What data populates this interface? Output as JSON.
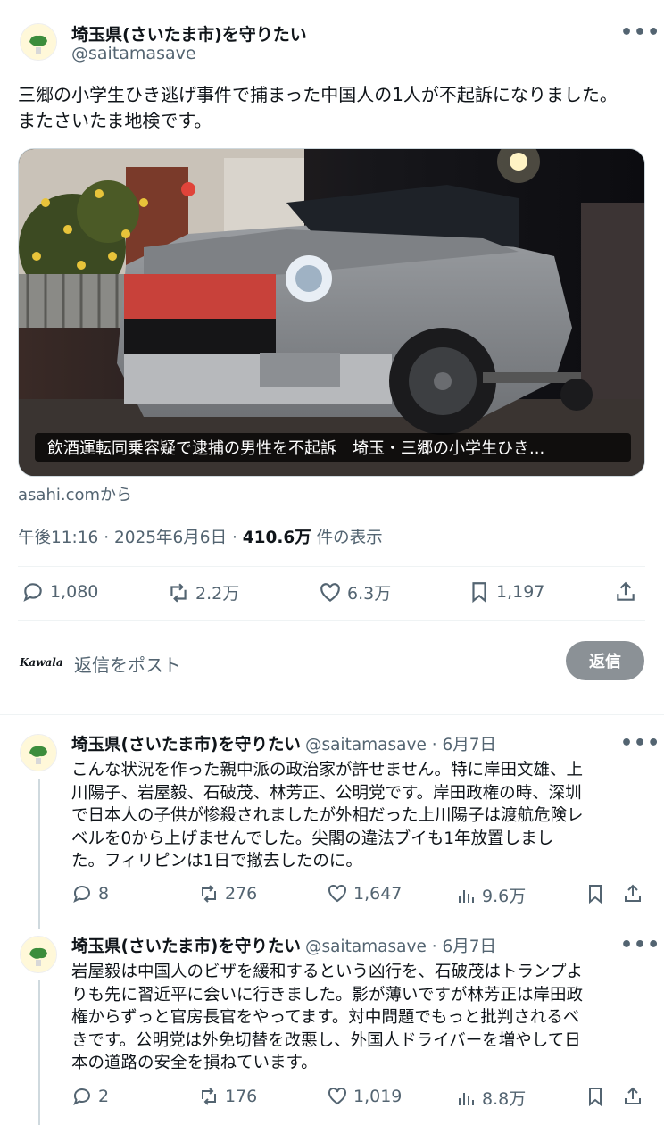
{
  "main_post": {
    "author_name": "埼玉県(さいたま市)を守りたい",
    "author_handle": "@saitamasave",
    "more_icon": "•••",
    "text_line1": "三郷の小学生ひき逃げ事件で捕まった中国人の1人が不起訴になりました。",
    "text_line2": "またさいたま地検です。",
    "card_caption": "飲酒運転同乗容疑で逮捕の男性を不起訴　埼玉・三郷の小学生ひき...",
    "card_source": "asahi.comから",
    "time": "午後11:16 · 2025年6月6日 · ",
    "views": "410.6万",
    "views_label": " 件の表示",
    "replies": "1,080",
    "reposts": "2.2万",
    "likes": "6.3万",
    "bookmarks": "1,197"
  },
  "reply_box": {
    "brand": "Kawala",
    "placeholder": "返信をポスト",
    "button": "返信"
  },
  "replies": [
    {
      "author_name": "埼玉県(さいたま市)を守りたい",
      "author_handle": "@saitamasave · 6月7日",
      "text_lines": [
        "こんな状況を作った親中派の政治家が許せません。特に岸田文雄、上",
        "川陽子、岩屋毅、石破茂、林芳正、公明党です。岸田政権の時、深圳",
        "で日本人の子供が惨殺されましたが外相だった上川陽子は渡航危険レ",
        "ベルを0から上げませんでした。尖閣の違法ブイも1年放置しまし",
        "た。フィリピンは1日で撤去したのに。"
      ],
      "replies": "8",
      "reposts": "276",
      "likes": "1,647",
      "views": "9.6万"
    },
    {
      "author_name": "埼玉県(さいたま市)を守りたい",
      "author_handle": "@saitamasave · 6月7日",
      "text_lines": [
        "岩屋毅は中国人のビザを緩和するという凶行を、石破茂はトランプよ",
        "りも先に習近平に会いに行きました。影が薄いですが林芳正は岸田政",
        "権からずっと官房長官をやってます。対中問題でもっと批判されるべ",
        "きです。公明党は外免切替を改悪し、外国人ドライバーを増やして日",
        "本の道路の安全を損ねています。"
      ],
      "replies": "2",
      "reposts": "176",
      "likes": "1,019",
      "views": "8.8万"
    }
  ],
  "icons": {
    "avatar": "saitama-map-avatar",
    "reply": "speech-bubble-icon",
    "repost": "repost-arrows-icon",
    "like": "heart-icon",
    "views": "bar-chart-icon",
    "bookmark": "bookmark-icon",
    "share": "share-icon"
  },
  "colors": {
    "text": "#0f1419",
    "secondary": "#536471",
    "reply_button": "#8b9196",
    "divider": "#eff3f4"
  }
}
